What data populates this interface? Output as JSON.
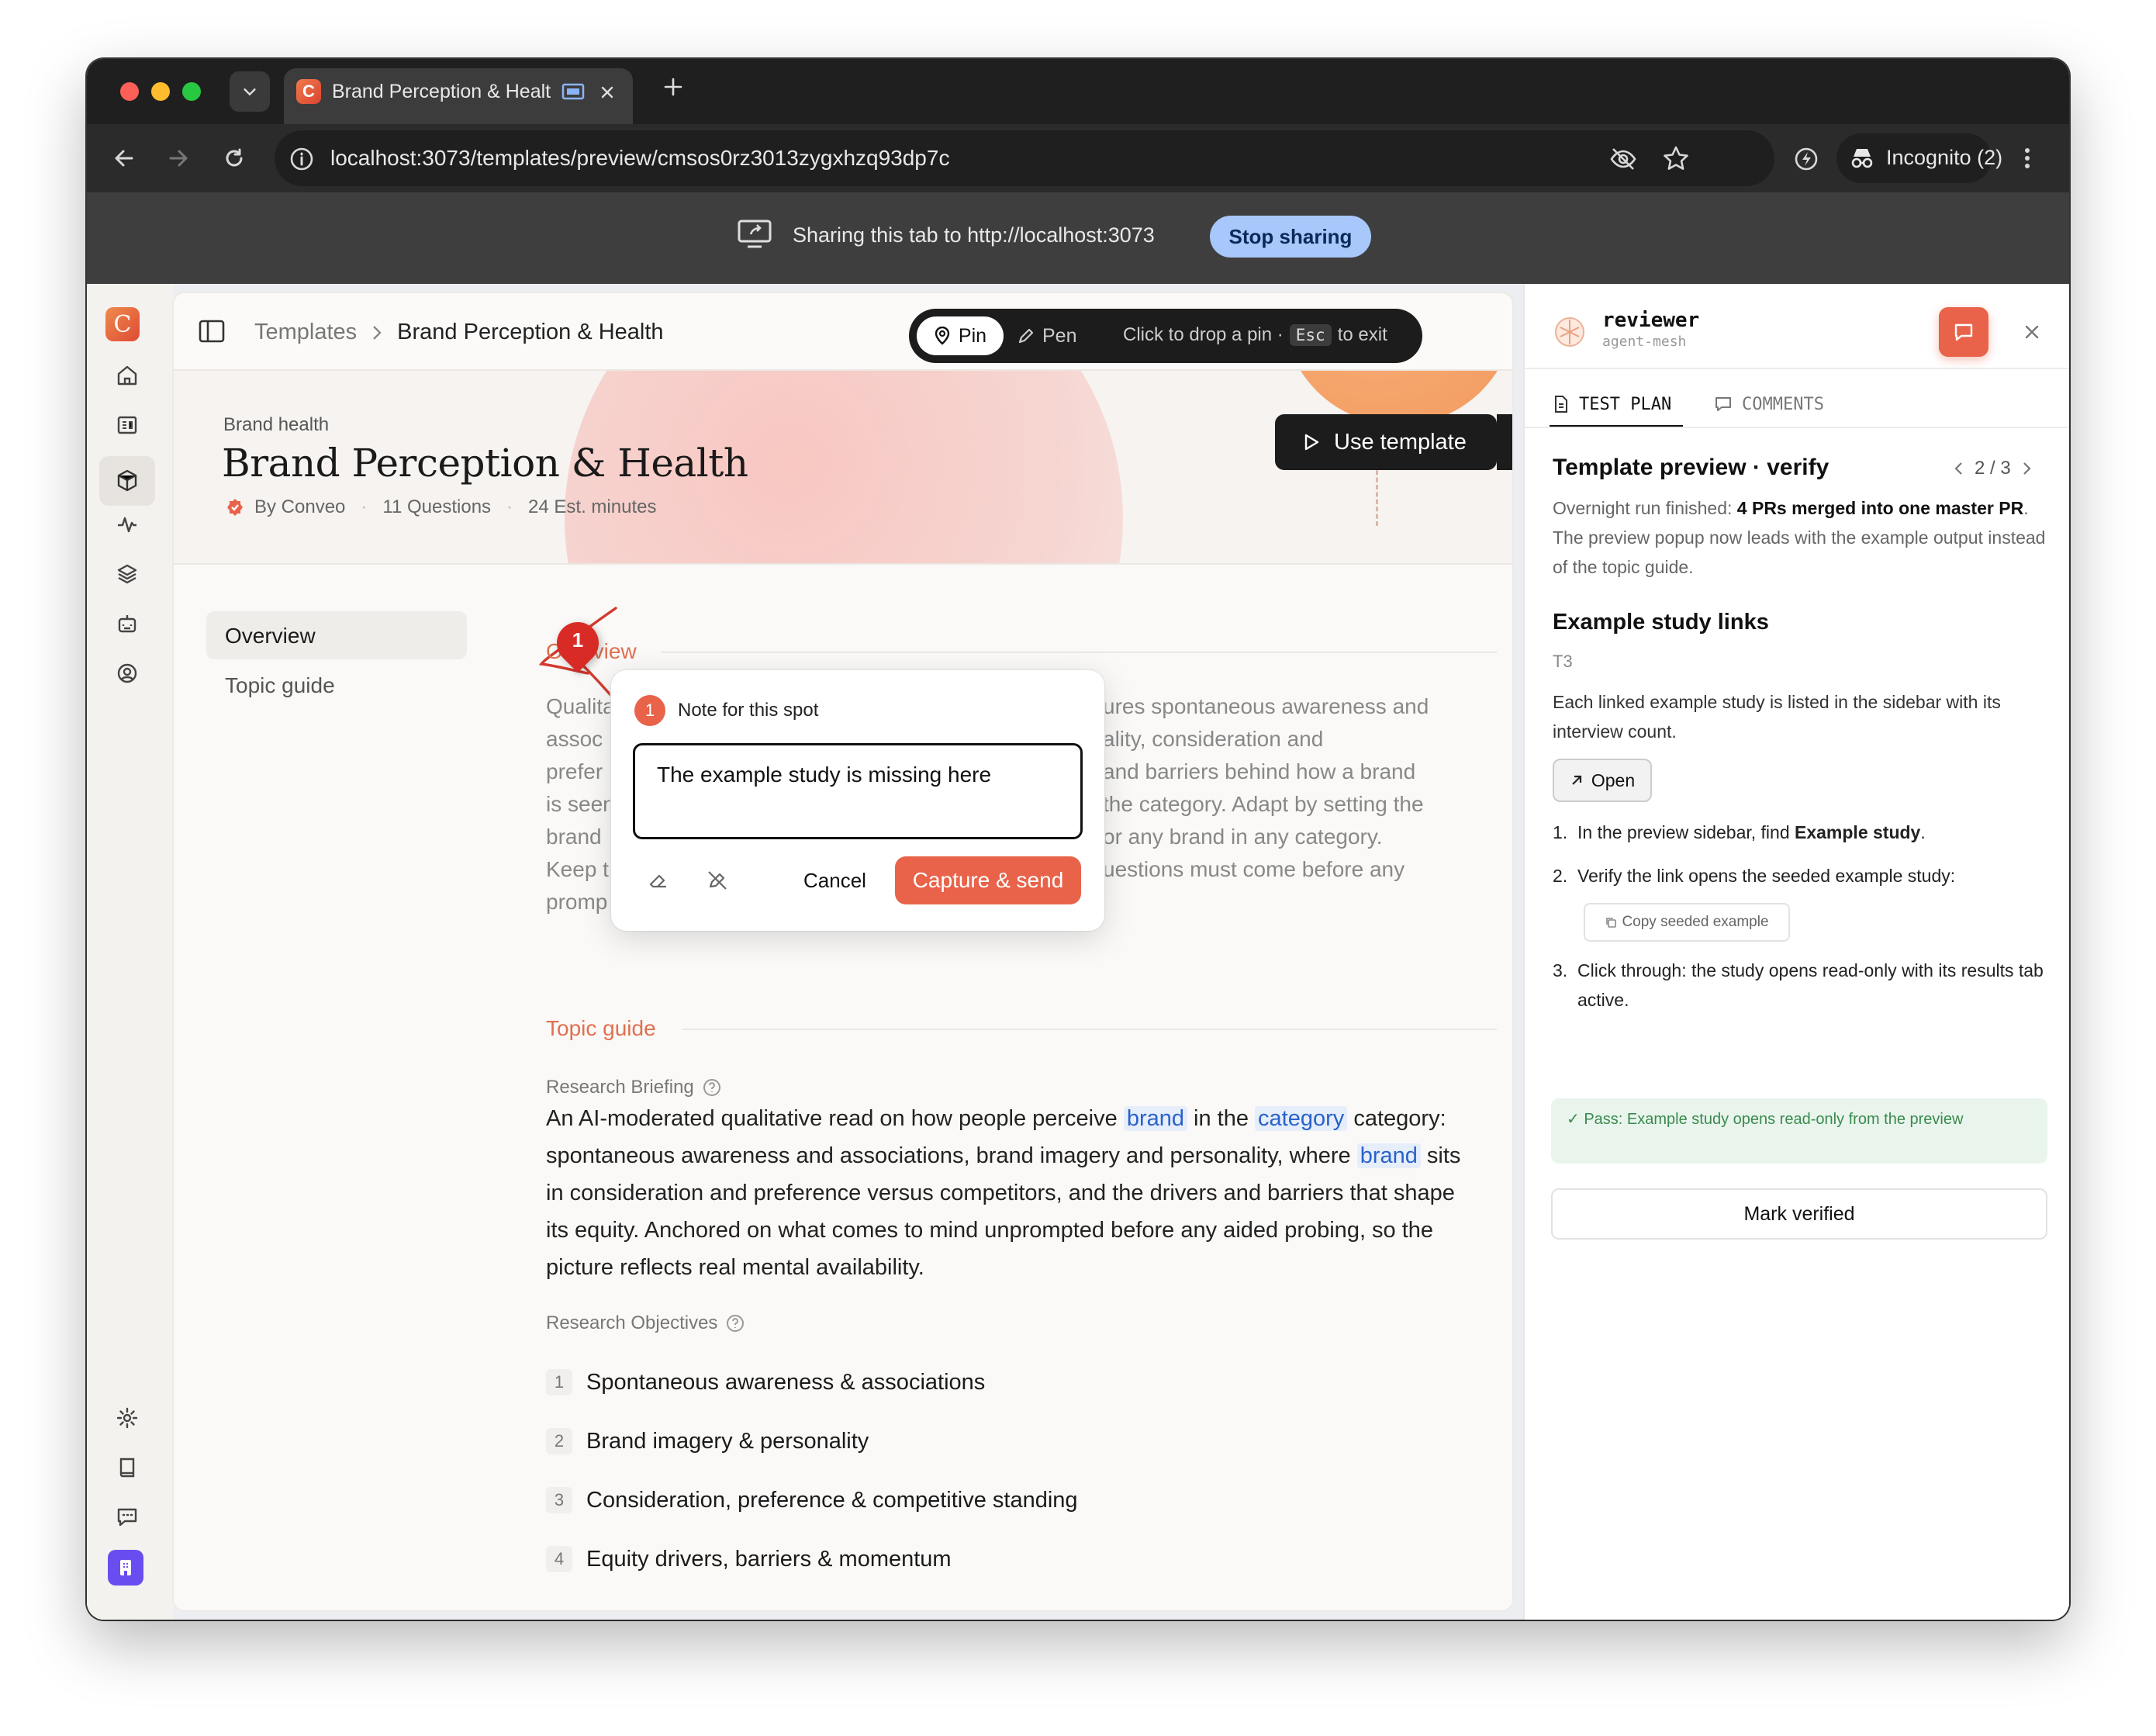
{
  "browser": {
    "tab_title": "Brand Perception & Healt",
    "url": "localhost:3073/templates/preview/cmsos0rz3013zygxhzq93dp7c",
    "profile_label": "Incognito (2)",
    "sharing_text": "Sharing this tab to http://localhost:3073",
    "stop_sharing_label": "Stop sharing"
  },
  "app": {
    "logo_letter": "C",
    "breadcrumb": {
      "parent": "Templates",
      "current": "Brand Perception & Health"
    },
    "pin_toolbar": {
      "pin_label": "Pin",
      "pen_label": "Pen",
      "hint_before": "Click to drop a pin ·",
      "hint_key": "Esc",
      "hint_after": "to exit"
    },
    "header": {
      "eyebrow": "Brand health",
      "title": "Brand Perception & Health",
      "author": "By Conveo",
      "questions": "11 Questions",
      "duration": "24 Est. minutes",
      "use_template_label": "Use template"
    },
    "nav": {
      "overview": "Overview",
      "topic_guide": "Topic guide"
    },
    "overview": {
      "section_title": "Overview",
      "body_left": [
        "Qualita",
        "assoc",
        "prefer",
        "is seen",
        "brand",
        "Keep t",
        "promp"
      ],
      "body_right": [
        "ures spontaneous awareness and",
        "ality, consideration and",
        "and barriers behind how a brand",
        "the category. Adapt by setting the",
        "or any brand in any category.",
        "uestions must come before any",
        ""
      ]
    },
    "pin_number": "1",
    "note_popup": {
      "badge": "1",
      "title": "Note for this spot",
      "text": "The example study is missing here",
      "cancel_label": "Cancel",
      "capture_label": "Capture & send"
    },
    "topic_guide": {
      "section_title": "Topic guide",
      "briefing_label": "Research Briefing",
      "briefing_text": {
        "p1": "An AI-moderated qualitative read on how people perceive ",
        "brand1": "brand",
        "p2": " in the ",
        "category": "category",
        "p3": " category: spontaneous awareness and associations, brand imagery and personality, where ",
        "brand2": "brand",
        "p4": " sits in consideration and preference versus competitors, and the drivers and barriers that shape its equity. Anchored on what comes to mind unprompted before any aided probing, so the picture reflects real mental availability."
      },
      "objectives_label": "Research Objectives",
      "objectives": [
        {
          "n": "1",
          "text": "Spontaneous awareness & associations"
        },
        {
          "n": "2",
          "text": "Brand imagery & personality"
        },
        {
          "n": "3",
          "text": "Consideration, preference & competitive standing"
        },
        {
          "n": "4",
          "text": "Equity drivers, barriers & momentum"
        }
      ]
    }
  },
  "reviewer": {
    "name": "reviewer",
    "subtitle": "agent-mesh",
    "tabs": {
      "test_plan": "TEST PLAN",
      "comments": "COMMENTS"
    },
    "plan_title": "Template preview · verify",
    "pager": "2 / 3",
    "summary": {
      "prefix": "Overnight run finished: ",
      "bold": "4 PRs merged into one master PR",
      "suffix": ". The preview popup now leads with the example output instead of the topic guide."
    },
    "section_title": "Example study links",
    "step_id": "T3",
    "step_desc": "Each linked example study is listed in the sidebar with its interview count.",
    "open_label": "Open",
    "steps": [
      {
        "n": "1.",
        "pre": "In the preview sidebar, find ",
        "bold": "Example study",
        "post": "."
      },
      {
        "n": "2.",
        "pre": "Verify the link opens the seeded example study:",
        "bold": "",
        "post": ""
      },
      {
        "n": "3.",
        "pre": "Click through: the study opens read-only with its results tab active.",
        "bold": "",
        "post": ""
      }
    ],
    "copy_label": "Copy seeded example",
    "pass_text": "✓ Pass: Example study opens read-only from the preview",
    "mark_verified_label": "Mark verified"
  },
  "colors": {
    "accent": "#e8634a",
    "link": "#2a62c9",
    "pass_bg": "#e9f5ec",
    "pass_text": "#3a8a4f",
    "dark": "#1c1c1c"
  }
}
